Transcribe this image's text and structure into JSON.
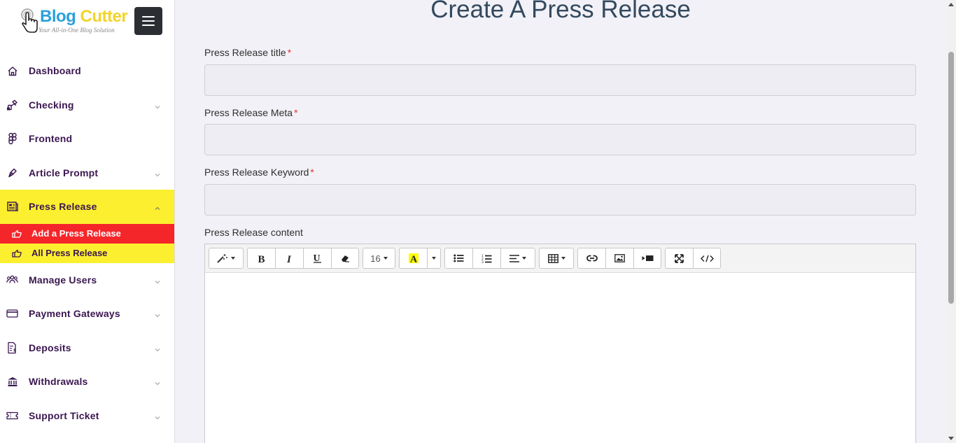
{
  "brand": {
    "name_part1": "Blog",
    "name_part2": "Cutter",
    "tagline": "Your All-in-One Blog Solution"
  },
  "sidebar": {
    "items": [
      {
        "label": "Dashboard",
        "icon": "home-icon",
        "has_chevron": false
      },
      {
        "label": "Checking",
        "icon": "drag-hand-icon",
        "has_chevron": true
      },
      {
        "label": "Frontend",
        "icon": "figma-icon",
        "has_chevron": false
      },
      {
        "label": "Article Prompt",
        "icon": "pen-icon",
        "has_chevron": true
      },
      {
        "label": "Press Release",
        "icon": "newspaper-icon",
        "has_chevron": true,
        "expanded": true
      },
      {
        "label": "Manage Users",
        "icon": "users-icon",
        "has_chevron": true
      },
      {
        "label": "Payment Gateways",
        "icon": "credit-card-icon",
        "has_chevron": true
      },
      {
        "label": "Deposits",
        "icon": "invoice-icon",
        "has_chevron": true
      },
      {
        "label": "Withdrawals",
        "icon": "bank-icon",
        "has_chevron": true
      },
      {
        "label": "Support Ticket",
        "icon": "ticket-icon",
        "has_chevron": true
      }
    ],
    "press_release_sub": [
      {
        "label": "Add a Press Release",
        "current": true
      },
      {
        "label": "All Press Release",
        "current": false
      }
    ]
  },
  "main": {
    "title": "Create A Press Release",
    "fields": {
      "title_label": "Press Release title",
      "meta_label": "Press Release Meta",
      "keyword_label": "Press Release Keyword",
      "content_label": "Press Release content",
      "required_mark": "*"
    },
    "editor": {
      "font_size": "16"
    }
  },
  "colors": {
    "highlight_yellow": "#fcef2f",
    "active_red": "#f5262a",
    "nav_text": "#3a1650",
    "title_color": "#34495e"
  }
}
